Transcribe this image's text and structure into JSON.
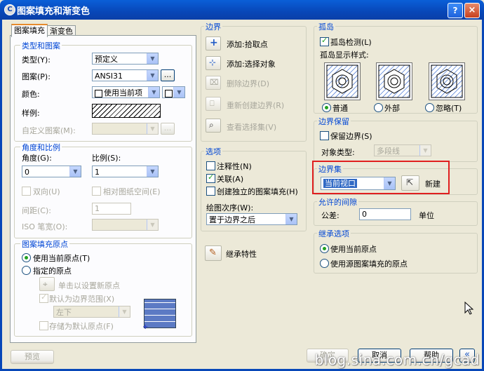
{
  "window": {
    "title": "图案填充和渐变色",
    "help": "?",
    "close": "×",
    "app_icon": "C"
  },
  "tabs": [
    "图案填充",
    "渐变色"
  ],
  "type_pattern": {
    "title": "类型和图案",
    "type_label": "类型(Y):",
    "type_value": "预定义",
    "pattern_label": "图案(P):",
    "pattern_value": "ANSI31",
    "pattern_btn": "...",
    "color_label": "颜色:",
    "color_value": "使用当前项",
    "swatch_label": "样例:",
    "custom_label": "自定义图案(M):",
    "custom_btn": "..."
  },
  "angle_scale": {
    "title": "角度和比例",
    "angle_label": "角度(G):",
    "angle_value": "0",
    "scale_label": "比例(S):",
    "scale_value": "1",
    "double_label": "双向(U)",
    "relative_label": "相对图纸空间(E)",
    "spacing_label": "间距(C):",
    "spacing_value": "1",
    "iso_label": "ISO 笔宽(O):"
  },
  "origin": {
    "title": "图案填充原点",
    "use_current": "使用当前原点(T)",
    "specified": "指定的原点",
    "click_set": "单击以设置新原点",
    "default_boundary": "默认为边界范围(X)",
    "position_value": "左下",
    "store_default": "存储为默认原点(F)"
  },
  "boundaries": {
    "title": "边界",
    "add_pick": "添加:拾取点",
    "add_select": "添加:选择对象",
    "remove": "删除边界(D)",
    "recreate": "重新创建边界(R)",
    "view_sel": "查看选择集(V)"
  },
  "options": {
    "title": "选项",
    "annotative": "注释性(N)",
    "associative": "关联(A)",
    "separate": "创建独立的图案填充(H)",
    "draw_order_label": "绘图次序(W):",
    "draw_order_value": "置于边界之后"
  },
  "inherit_label": "继承特性",
  "islands": {
    "title": "孤岛",
    "detect": "孤岛检测(L)",
    "style_label": "孤岛显示样式:",
    "normal": "普通",
    "outer": "外部",
    "ignore": "忽略(T)"
  },
  "boundary_retention": {
    "title": "边界保留",
    "retain": "保留边界(S)",
    "obj_type_label": "对象类型:",
    "obj_type_value": "多段线"
  },
  "boundary_set": {
    "title": "边界集",
    "value": "当前视口",
    "new_label": "新建"
  },
  "gap": {
    "title": "允许的间隙",
    "tolerance_label": "公差:",
    "value": "0",
    "unit": "单位"
  },
  "inherit_options": {
    "title": "继承选项",
    "use_current": "使用当前原点",
    "use_source": "使用源图案填充的原点"
  },
  "buttons": {
    "preview": "预览",
    "ok": "确定",
    "cancel": "取消",
    "help": "帮助",
    "more": "«"
  },
  "watermark": "blog.sina.com.cn/gcad"
}
